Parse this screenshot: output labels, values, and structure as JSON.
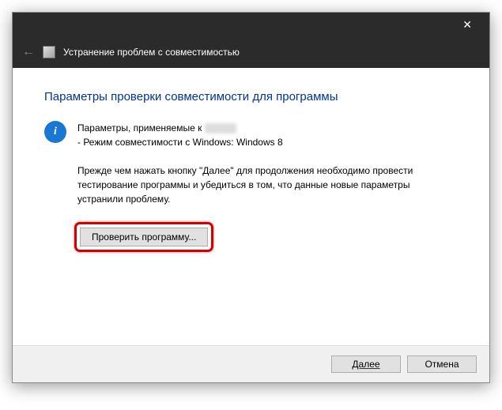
{
  "header": {
    "title": "Устранение проблем с совместимостью"
  },
  "page": {
    "title": "Параметры проверки совместимости для программы"
  },
  "info": {
    "line1_prefix": "Параметры, применяемые к",
    "line2": "- Режим совместимости с Windows: Windows 8"
  },
  "instruction": "Прежде чем нажать кнопку \"Далее\" для продолжения необходимо провести тестирование программы и убедиться в том, что данные новые параметры устранили проблему.",
  "buttons": {
    "test": "Проверить программу...",
    "next": "Далее",
    "cancel": "Отмена"
  }
}
